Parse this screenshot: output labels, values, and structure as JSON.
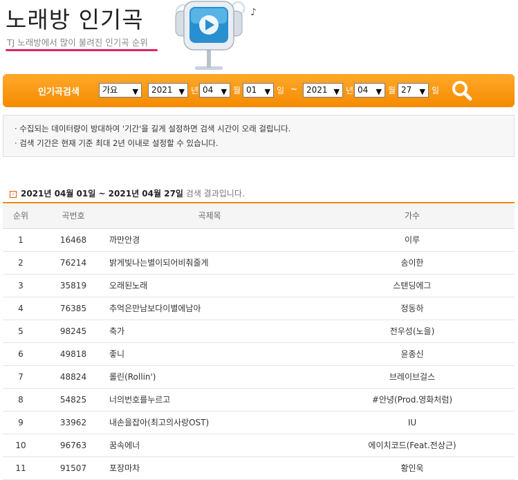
{
  "header": {
    "title": "노래방 인기곡",
    "subtitle": "TJ 노래방에서 많이 불려진 인기곡 순위"
  },
  "search": {
    "label": "인기곡검색",
    "genre": "가요",
    "start_year": "2021",
    "year_unit": "년",
    "start_month": "04",
    "month_unit": "월",
    "start_day": "01",
    "day_unit": "일",
    "separator": "~",
    "end_year": "2021",
    "end_month": "04",
    "end_day": "27"
  },
  "notice": {
    "lines": [
      "· 수집되는 데이터량이 방대하여 '기간'을 길게 설정하면 검색 시간이 오래 걸립니다.",
      "· 검색 기간은 현재 기준 최대 2년 이내로 설정할 수 있습니다."
    ]
  },
  "result": {
    "date_range": "2021년 04월 01일 ~ 2021년 04월 27일",
    "suffix": " 검색 결과입니다."
  },
  "table": {
    "headers": {
      "rank": "순위",
      "number": "곡번호",
      "title": "곡제목",
      "singer": "가수"
    },
    "rows": [
      {
        "rank": "1",
        "number": "16468",
        "title": "까만안경",
        "singer": "이루"
      },
      {
        "rank": "2",
        "number": "76214",
        "title": "밝게빛나는별이되어비춰줄게",
        "singer": "송이한"
      },
      {
        "rank": "3",
        "number": "35819",
        "title": "오래된노래",
        "singer": "스탠딩에그"
      },
      {
        "rank": "4",
        "number": "76385",
        "title": "추억은만남보다이별에남아",
        "singer": "정동하"
      },
      {
        "rank": "5",
        "number": "98245",
        "title": "축가",
        "singer": "전우성(노을)"
      },
      {
        "rank": "6",
        "number": "49818",
        "title": "좋니",
        "singer": "윤종신"
      },
      {
        "rank": "7",
        "number": "48824",
        "title": "롤린(Rollin')",
        "singer": "브레이브걸스"
      },
      {
        "rank": "8",
        "number": "54825",
        "title": "너의번호를누르고",
        "singer": "#안녕(Prod.영화처럼)"
      },
      {
        "rank": "9",
        "number": "33962",
        "title": "내손을잡아(최고의사랑OST)",
        "singer": "IU"
      },
      {
        "rank": "10",
        "number": "96763",
        "title": "꿈속에너",
        "singer": "에이치코드(Feat.전상근)"
      },
      {
        "rank": "11",
        "number": "91507",
        "title": "포장마차",
        "singer": "황인욱"
      }
    ]
  },
  "colors": {
    "accent_orange": "#f58a00",
    "underline_pink": "#e0245e"
  },
  "icons": {
    "logo": "tv-robot-icon",
    "search": "magnifier-icon",
    "result": "arrow-box-icon"
  }
}
